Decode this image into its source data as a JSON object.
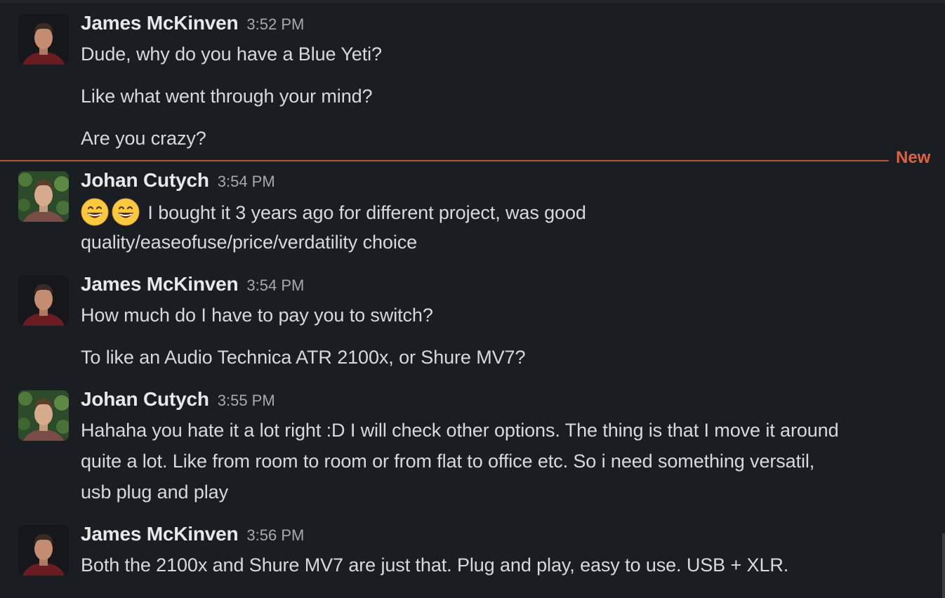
{
  "new_divider": {
    "label": "New",
    "color": "#e0633f"
  },
  "messages": [
    {
      "sender": "James McKinven",
      "time": "3:52 PM",
      "avatar": "james-avatar",
      "lines": [
        "Dude, why do you have a Blue Yeti?",
        "Like what went through your mind?",
        "Are you crazy?"
      ]
    },
    {
      "sender": "Johan Cutych",
      "time": "3:54 PM",
      "avatar": "johan-avatar",
      "emoji": "grinning-face-emoji",
      "lines": [
        "I bought it 3 years ago for different project, was good",
        "quality/easeofuse/price/verdatility choice"
      ]
    },
    {
      "sender": "James McKinven",
      "time": "3:54 PM",
      "avatar": "james-avatar",
      "lines": [
        "How much do I have to pay you to switch?",
        "To like an Audio Technica ATR 2100x, or Shure MV7?"
      ]
    },
    {
      "sender": "Johan Cutych",
      "time": "3:55 PM",
      "avatar": "johan-avatar",
      "lines": [
        "Hahaha you hate it a lot right :D I will check other options. The thing is that I move it around",
        "quite a lot. Like from room to room or from flat to office etc. So i need something versatil,",
        "usb plug and play"
      ]
    },
    {
      "sender": "James McKinven",
      "time": "3:56 PM",
      "avatar": "james-avatar",
      "lines": [
        "Both the 2100x and Shure MV7 are just that. Plug and play, easy to use. USB + XLR."
      ]
    }
  ]
}
